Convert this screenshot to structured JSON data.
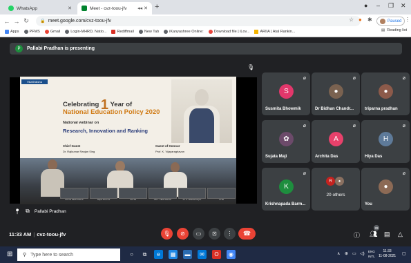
{
  "browser": {
    "tabs": [
      {
        "label": "WhatsApp"
      },
      {
        "label": "Meet - cvz-toou-jfv"
      }
    ],
    "new_tab": "+",
    "url": "meet.google.com/cvz-toou-jfv",
    "profile_status": "Paused",
    "bookmarks": [
      {
        "label": "Apps",
        "color": "#4285f4"
      },
      {
        "label": "PFMS",
        "color": "#5f6368"
      },
      {
        "label": "Gmail",
        "color": "#ea4335"
      },
      {
        "label": "Login-MHRD, Natio...",
        "color": "#5f6368"
      },
      {
        "label": "Rediffmail",
        "color": "#d93025"
      },
      {
        "label": "New Tab",
        "color": "#5f6368"
      },
      {
        "label": "iKanyashree Online:",
        "color": "#5f6368"
      },
      {
        "label": "Download file | iLov...",
        "color": "#e8453c"
      },
      {
        "label": "ARIIA | Atal Rankin...",
        "color": "#f4b400"
      }
    ],
    "reading_list": "Reading list"
  },
  "meet": {
    "presenter_initial": "P",
    "presenting_text": "Pallabi Pradhan is presenting",
    "presentation": {
      "brand": "VikaShiksha",
      "line1_pre": "Celebrating",
      "line1_num": "1",
      "line1_post": "Year of",
      "line2": "National Education Policy 2020",
      "line3": "National webinar on",
      "line4": "Research, Innovation and Ranking",
      "chief_guest_label": "Chief Guest",
      "chief_guest": "Dr. Rajkumar Ranjan Sing",
      "guest_label": "Guest of Honour",
      "guest": "Prof. K. Vijayaraghavan",
      "strip_labels": [
        "AICTE NEW DELHI",
        "Rajat Sharma",
        "AICTE",
        "VAC - NEW DELHI",
        "Dr. A. Bhattacharjee",
        "ICTE"
      ]
    },
    "presenter_label": "Pallabi Pradhan",
    "participants": [
      {
        "name": "Susmita Bhowmik",
        "initial": "S",
        "color": "#e2376b"
      },
      {
        "name": "Dr Bidhan Chandr...",
        "initial": "",
        "color": "#7a6250"
      },
      {
        "name": "triparna pradhan",
        "initial": "",
        "color": "#8c5a4a"
      },
      {
        "name": "Sujata Maji",
        "initial": "",
        "color": "#6c4a6a"
      },
      {
        "name": "Archita Das",
        "initial": "A",
        "color": "#e8416b"
      },
      {
        "name": "Hiya Das",
        "initial": "H",
        "color": "#5e7a99"
      },
      {
        "name": "Krishnapada Barm...",
        "initial": "K",
        "color": "#1e8e3e"
      },
      {
        "name": "20 others",
        "initial": "R",
        "color": "#c5221f"
      },
      {
        "name": "You",
        "initial": "",
        "color": "#8c6a55"
      }
    ],
    "time": "11:33 AM",
    "meeting_code": "cvz-toou-jfv",
    "participant_count": "29"
  },
  "taskbar": {
    "search_placeholder": "Type here to search",
    "lang": "ENG",
    "region": "INTL",
    "time": "11:33",
    "date": "11-08-2021"
  }
}
